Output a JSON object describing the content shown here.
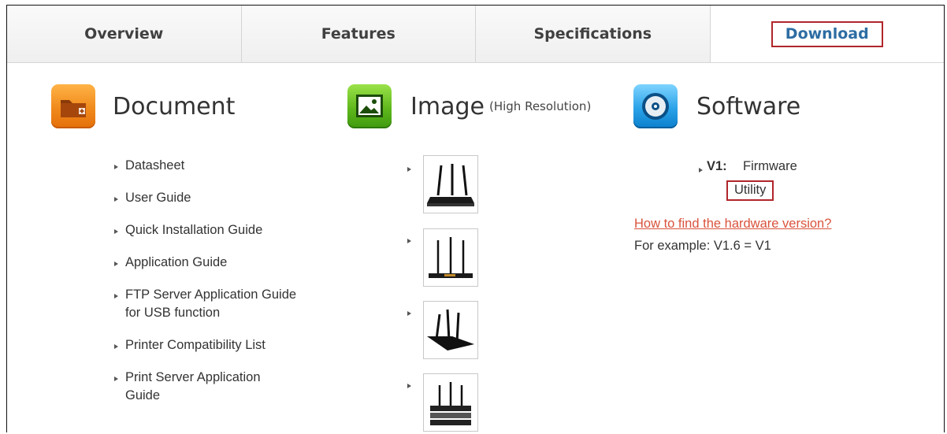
{
  "tabs": [
    {
      "label": "Overview",
      "active": false
    },
    {
      "label": "Features",
      "active": false
    },
    {
      "label": "Specifications",
      "active": false
    },
    {
      "label": "Download",
      "active": true
    }
  ],
  "document": {
    "title": "Document",
    "icon": "folder-icon",
    "links": [
      "Datasheet",
      "User Guide",
      "Quick Installation Guide",
      "Application Guide",
      "FTP Server Application Guide for USB function",
      "Printer Compatibility List",
      "Print Server Application Guide"
    ]
  },
  "image": {
    "title": "Image",
    "subtitle": "(High Resolution)",
    "icon": "picture-icon",
    "thumbnails": [
      "router-front-icon",
      "router-rear-icon",
      "router-angle-icon",
      "router-stacked-icon"
    ]
  },
  "software": {
    "title": "Software",
    "icon": "disc-icon",
    "version": "V1:",
    "firmware_label": "Firmware",
    "utility_label": "Utility",
    "hw_link": "How to find the hardware version?",
    "example": "For example: V1.6 = V1"
  },
  "colors": {
    "active_tab_text": "#2d6da3",
    "highlight_border": "#b0262b",
    "link_red": "#d9533c",
    "doc_icon": "#f08a1c",
    "image_icon": "#5fb81c",
    "software_icon": "#2aa2e8"
  }
}
